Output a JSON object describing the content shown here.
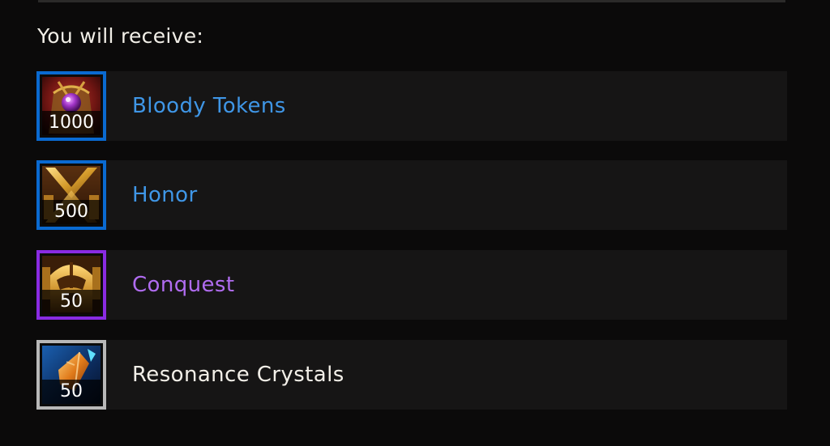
{
  "heading": "You will receive:",
  "rewards": [
    {
      "name": "Bloody Tokens",
      "quantity": "1000",
      "icon": "bloody-token-icon",
      "quality_color": "#0a6ad1",
      "name_color": "#3f96e6"
    },
    {
      "name": "Honor",
      "quantity": "500",
      "icon": "honor-icon",
      "quality_color": "#0a6ad1",
      "name_color": "#3f96e6"
    },
    {
      "name": "Conquest",
      "quantity": "50",
      "icon": "conquest-icon",
      "quality_color": "#8a2be2",
      "name_color": "#b06cf0"
    },
    {
      "name": "Resonance Crystals",
      "quantity": "50",
      "icon": "resonance-crystal-icon",
      "quality_color": "#b8b8b8",
      "name_color": "#f2efe8"
    }
  ]
}
